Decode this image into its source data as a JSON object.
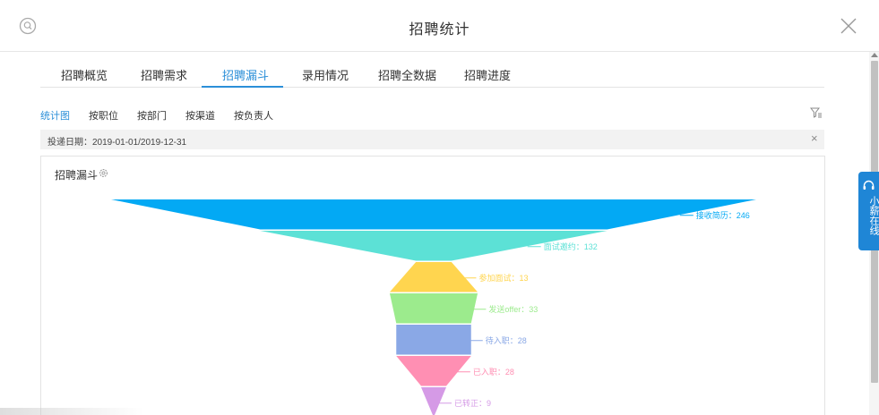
{
  "header": {
    "title": "招聘统计",
    "help_icon": "search-help-icon",
    "close_icon": "close-icon"
  },
  "tabs": [
    {
      "label": "招聘概览",
      "active": false
    },
    {
      "label": "招聘需求",
      "active": false
    },
    {
      "label": "招聘漏斗",
      "active": true
    },
    {
      "label": "录用情况",
      "active": false
    },
    {
      "label": "招聘全数据",
      "active": false
    },
    {
      "label": "招聘进度",
      "active": false
    }
  ],
  "subtabs": [
    {
      "label": "统计图",
      "active": true
    },
    {
      "label": "按职位",
      "active": false
    },
    {
      "label": "按部门",
      "active": false
    },
    {
      "label": "按渠道",
      "active": false
    },
    {
      "label": "按负责人",
      "active": false
    }
  ],
  "filter": {
    "date_text": "投递日期：2019-01-01/2019-12-31",
    "clear_label": "×"
  },
  "panel": {
    "title": "招聘漏斗"
  },
  "online_widget": {
    "label": "小薪在线"
  },
  "colors": {
    "accent": "#2b8fd8",
    "widget": "#1f86d6"
  },
  "chart_data": {
    "type": "funnel",
    "stages": [
      {
        "name": "接收简历",
        "value": 246,
        "color": "#03a9f4"
      },
      {
        "name": "面试邀约",
        "value": 132,
        "color": "#5ce1d6"
      },
      {
        "name": "参加面试",
        "value": 13,
        "color": "#ffd54f"
      },
      {
        "name": "发送offer",
        "value": 33,
        "color": "#9ceb8d"
      },
      {
        "name": "待入职",
        "value": 28,
        "color": "#8aa8e6"
      },
      {
        "name": "已入职",
        "value": 28,
        "color": "#ff8fb3"
      },
      {
        "name": "已转正",
        "value": 9,
        "color": "#d59ae6"
      }
    ]
  }
}
